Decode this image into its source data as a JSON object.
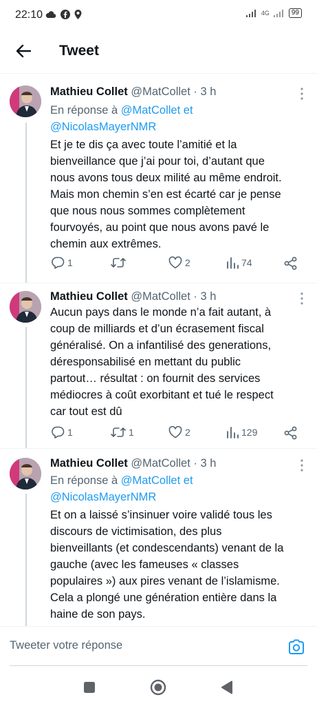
{
  "status_bar": {
    "time": "22:10",
    "network": "4G",
    "battery": "99"
  },
  "header": {
    "title": "Tweet"
  },
  "tweets": [
    {
      "name": "Mathieu Collet",
      "handle": "@MatCollet",
      "time": "· 3 h",
      "reply_prefix": "En réponse à ",
      "reply_to_1": "@MatCollet",
      "reply_and": " et",
      "reply_to_2": "@NicolasMayerNMR",
      "text_lines": [
        "Et je te dis ça avec toute l’amitié et la",
        "bienveillance que j’ai pour toi, d’autant que",
        "nous avons tous deux milité au même endroit.",
        "Mais mon chemin s’en est écarté car je pense",
        "que nous nous sommes complètement",
        "fourvoyés, au point que nous avons pavé le",
        "chemin aux extrêmes."
      ],
      "replies": "1",
      "retweets": "",
      "likes": "2",
      "views": "74"
    },
    {
      "name": "Mathieu Collet",
      "handle": "@MatCollet",
      "time": "· 3 h",
      "text_lines": [
        "Aucun pays dans le monde n’a fait autant, à",
        "coup de milliards et d’un écrasement fiscal",
        "généralisé. On a infantilisé des generations,",
        "déresponsabilisé en mettant du public",
        "partout… résultat : on fournit des services",
        "médiocres à coût exorbitant et tué le respect",
        "car tout est dû"
      ],
      "replies": "1",
      "retweets": "1",
      "likes": "2",
      "views": "129"
    },
    {
      "name": "Mathieu Collet",
      "handle": "@MatCollet",
      "time": "· 3 h",
      "reply_prefix": "En réponse à ",
      "reply_to_1": "@MatCollet",
      "reply_and": " et",
      "reply_to_2": "@NicolasMayerNMR",
      "text_lines": [
        "Et on a laissé s’insinuer voire validé tous les",
        "discours de victimisation, des plus",
        "bienveillants (et condescendants) venant de la",
        "gauche (avec les fameuses « classes",
        "populaires ») aux pires venant de l’islamisme.",
        "Cela a plongé une génération entière dans la",
        "haine de son pays."
      ]
    }
  ],
  "compose": {
    "placeholder": "Tweeter votre réponse"
  },
  "icons": {
    "back": "arrow-left-icon",
    "more": "more-vertical-icon",
    "reply": "comment-icon",
    "retweet": "retweet-icon",
    "like": "heart-icon",
    "views": "analytics-icon",
    "share": "share-icon",
    "camera": "camera-icon",
    "nav_recents": "square-icon",
    "nav_home": "circle-icon",
    "nav_back": "triangle-back-icon"
  },
  "colors": {
    "accent": "#1d9bf0",
    "text": "#0f1419",
    "secondary": "#536471"
  }
}
